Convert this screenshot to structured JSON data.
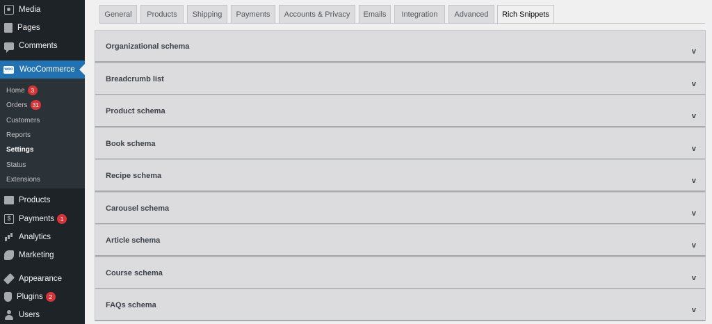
{
  "sidebar": {
    "items_top": [
      {
        "label": "Media",
        "icon": "media-icon"
      },
      {
        "label": "Pages",
        "icon": "pages-icon"
      },
      {
        "label": "Comments",
        "icon": "comments-icon"
      }
    ],
    "woocommerce": {
      "label": "WooCommerce",
      "icon": "woocommerce-icon",
      "logo_text": "woo"
    },
    "submenu": [
      {
        "label": "Home",
        "badge": "3"
      },
      {
        "label": "Orders",
        "badge": "31"
      },
      {
        "label": "Customers"
      },
      {
        "label": "Reports"
      },
      {
        "label": "Settings",
        "current": true
      },
      {
        "label": "Status"
      },
      {
        "label": "Extensions"
      }
    ],
    "items_bottom": [
      {
        "label": "Products",
        "icon": "products-icon"
      },
      {
        "label": "Payments",
        "icon": "payments-icon",
        "badge": "1",
        "icon_glyph": "$"
      },
      {
        "label": "Analytics",
        "icon": "analytics-icon"
      },
      {
        "label": "Marketing",
        "icon": "marketing-icon"
      },
      {
        "label": "Appearance",
        "icon": "appearance-icon"
      },
      {
        "label": "Plugins",
        "icon": "plugins-icon",
        "badge": "2"
      },
      {
        "label": "Users",
        "icon": "users-icon"
      }
    ]
  },
  "tabs": [
    {
      "label": "General"
    },
    {
      "label": "Products"
    },
    {
      "label": "Shipping"
    },
    {
      "label": "Payments"
    },
    {
      "label": "Accounts & Privacy"
    },
    {
      "label": "Emails"
    },
    {
      "label": "Integration"
    },
    {
      "label": "Advanced"
    },
    {
      "label": "Rich Snippets",
      "active": true
    }
  ],
  "sections": [
    {
      "title": "Organizational schema",
      "chevron": "v"
    },
    {
      "title": "Breadcrumb list",
      "chevron": "v"
    },
    {
      "title": "Product schema",
      "chevron": "v"
    },
    {
      "title": "Book schema",
      "chevron": "v"
    },
    {
      "title": "Recipe schema",
      "chevron": "v"
    },
    {
      "title": "Carousel schema",
      "chevron": "v"
    },
    {
      "title": "Article schema",
      "chevron": "v"
    },
    {
      "title": "Course schema",
      "chevron": "v"
    },
    {
      "title": "FAQs schema",
      "chevron": "v"
    }
  ],
  "colors": {
    "sidebar_bg": "#1d2327",
    "submenu_bg": "#2c3338",
    "accent": "#2271b1",
    "badge": "#d63638"
  }
}
